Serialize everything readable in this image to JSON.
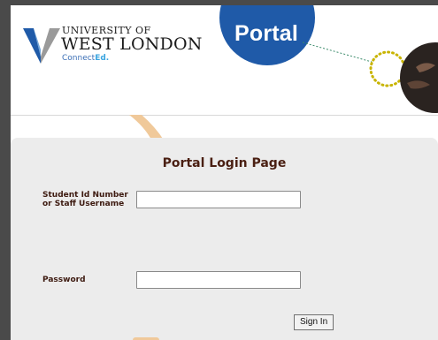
{
  "header": {
    "logo": {
      "line1": "UNIVERSITY OF",
      "line2": "WEST LONDON",
      "connect_prefix": "Connect",
      "connect_suffix": "Ed."
    },
    "portal_badge": "Portal"
  },
  "login": {
    "title": "Portal Login Page",
    "username_label_line1": "Student Id Number",
    "username_label_line2": "or Staff Username",
    "username_value": "",
    "password_label": "Password",
    "password_value": "",
    "signin_label": "Sign In"
  },
  "colors": {
    "brand_blue": "#1f5aa8",
    "title_brown": "#4a1f12",
    "accent_orange": "#f0c99a",
    "dot_yellow": "#c8b400",
    "line_green": "#3a8a6a"
  }
}
